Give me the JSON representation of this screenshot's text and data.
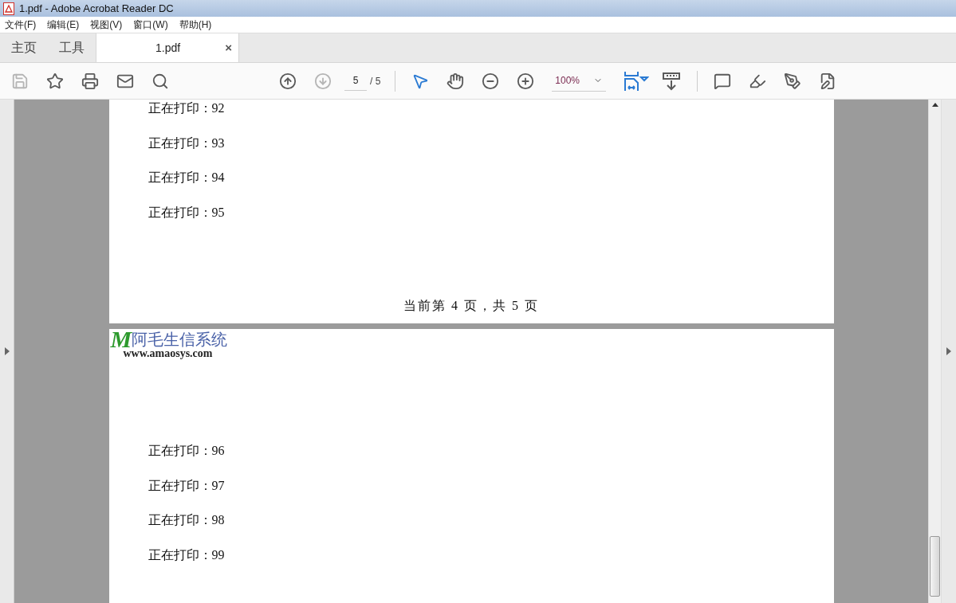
{
  "window": {
    "title": "1.pdf - Adobe Acrobat Reader DC"
  },
  "menu": [
    "文件(F)",
    "编辑(E)",
    "视图(V)",
    "窗口(W)",
    "帮助(H)"
  ],
  "tabs": [
    {
      "label": "主页",
      "selected": false
    },
    {
      "label": "工具",
      "selected": false
    },
    {
      "label": "1.pdf",
      "selected": true,
      "close": "×"
    }
  ],
  "toolbar": {
    "left": [
      {
        "kind": "save",
        "disabled": true
      },
      {
        "kind": "bookmark",
        "disabled": false
      },
      {
        "kind": "print",
        "disabled": false
      },
      {
        "kind": "mail",
        "disabled": false
      },
      {
        "kind": "search",
        "disabled": false
      }
    ],
    "nav": [
      {
        "kind": "up",
        "disabled": false
      },
      {
        "kind": "down",
        "disabled": true
      }
    ],
    "page_field": "5",
    "page_total": "/ 5",
    "tools": [
      {
        "kind": "select",
        "selected": true
      },
      {
        "kind": "hand",
        "selected": false
      },
      {
        "kind": "zoom_out",
        "selected": false
      },
      {
        "kind": "zoom_in",
        "selected": false
      }
    ],
    "zoom": "100%",
    "right": [
      {
        "kind": "comment"
      },
      {
        "kind": "highlight"
      },
      {
        "kind": "sign"
      },
      {
        "kind": "edit"
      }
    ]
  },
  "pages": [
    {
      "lines": [
        "正在打印：92",
        "正在打印：93",
        "正在打印：94",
        "正在打印：95"
      ],
      "footer": "当前第 4 页，共 5 页"
    },
    {
      "logo": {
        "mark": "M",
        "title": "阿毛生信系统",
        "url": "www.amaosys.com"
      },
      "lines": [
        "正在打印：96",
        "正在打印：97",
        "正在打印：98",
        "正在打印：99"
      ]
    }
  ]
}
